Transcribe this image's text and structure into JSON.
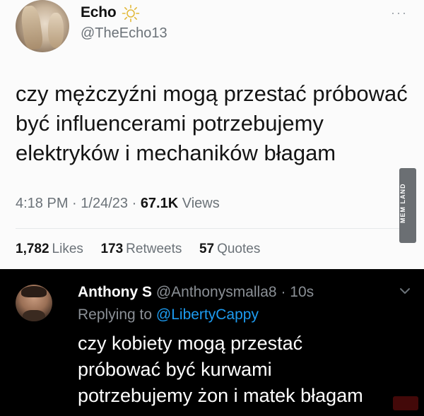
{
  "tweet": {
    "author_name": "Echo",
    "author_handle": "@TheEcho13",
    "more_label": "···",
    "lines": [
      "czy mężczyźni mogą przestać próbować",
      "być influencerami potrzebujemy",
      "elektryków i mechaników błagam"
    ],
    "time": "4:18 PM",
    "date": "1/24/23",
    "separator": "·",
    "views_count": "67.1K",
    "views_label": "Views",
    "likes_count": "1,782",
    "likes_label": "Likes",
    "retweets_count": "173",
    "retweets_label": "Retweets",
    "quotes_count": "57",
    "quotes_label": "Quotes"
  },
  "watermark": {
    "text": "MEM LAND"
  },
  "reply": {
    "author_name": "Anthony S",
    "author_handle": "@Anthonysmalla8",
    "separator": "·",
    "age": "10s",
    "replying_to_label": "Replying to",
    "replying_to_handle": "@LibertyCappy",
    "lines": [
      "czy kobiety mogą przestać",
      "próbować być kurwami",
      "potrzebujemy żon i matek błagam"
    ]
  },
  "colors": {
    "link": "#1d9bf0",
    "muted": "#6b7278",
    "dark_bg": "#000000",
    "sun_icon": "#e2b93b"
  }
}
